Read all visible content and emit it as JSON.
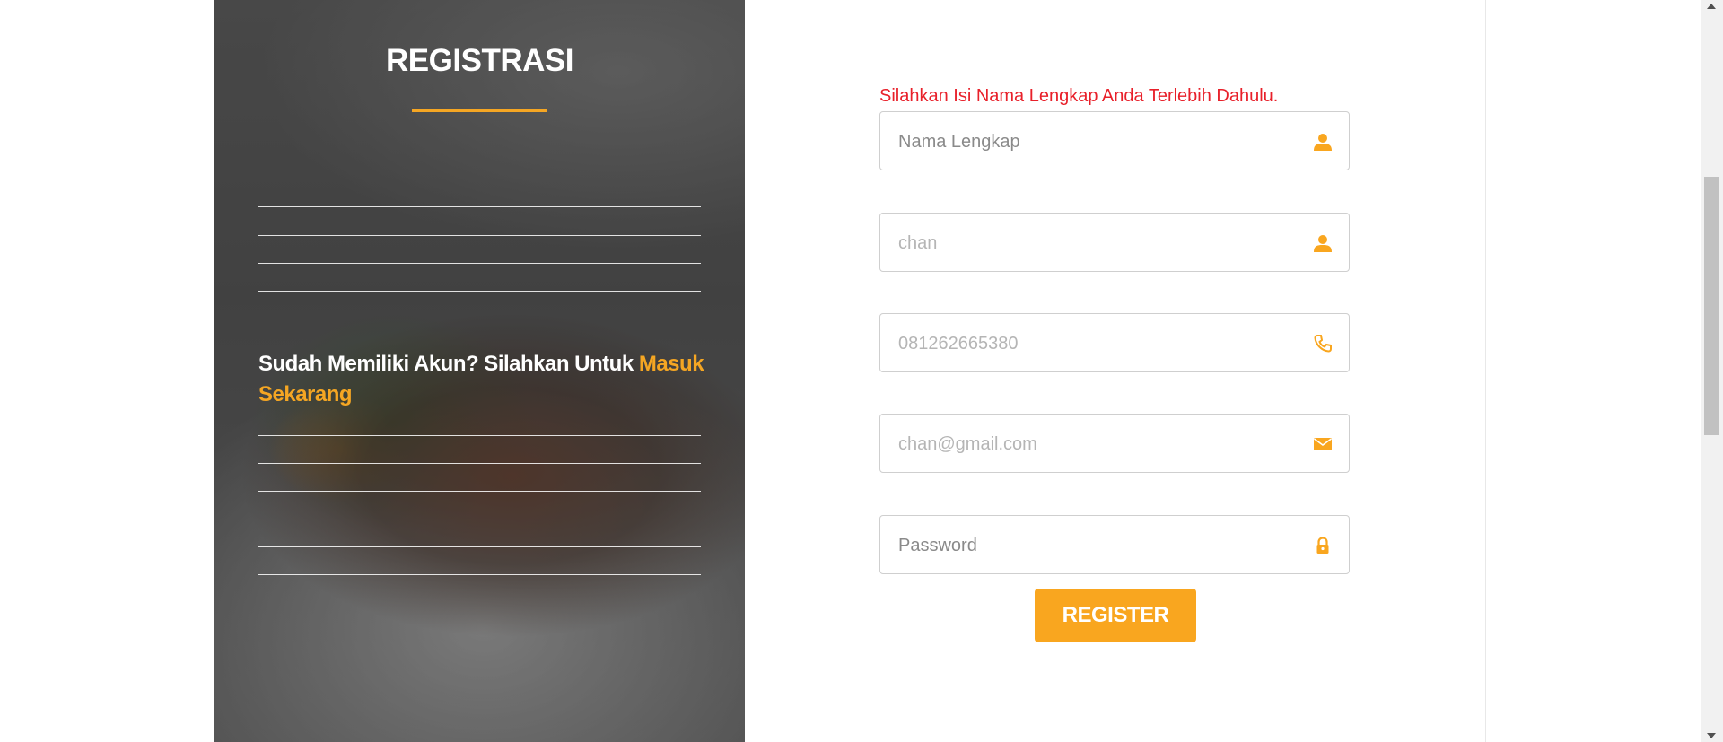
{
  "sidebar": {
    "title": "REGISTRASI",
    "login_prompt": "Sudah Memiliki Akun? Silahkan Untuk ",
    "login_link": "Masuk Sekarang"
  },
  "form": {
    "error_message": "Silahkan Isi Nama Lengkap Anda Terlebih Dahulu.",
    "fields": [
      {
        "placeholder": "Nama Lengkap",
        "icon": "user-icon"
      },
      {
        "placeholder": "chan",
        "icon": "user-icon"
      },
      {
        "placeholder": "081262665380",
        "icon": "phone-icon"
      },
      {
        "placeholder": "chan@gmail.com",
        "icon": "envelope-icon"
      },
      {
        "placeholder": "Password",
        "icon": "lock-icon"
      }
    ],
    "register_label": "REGISTER"
  },
  "colors": {
    "accent": "#f9a61f",
    "error": "#e8202a",
    "panel": "#4d4d4d"
  }
}
